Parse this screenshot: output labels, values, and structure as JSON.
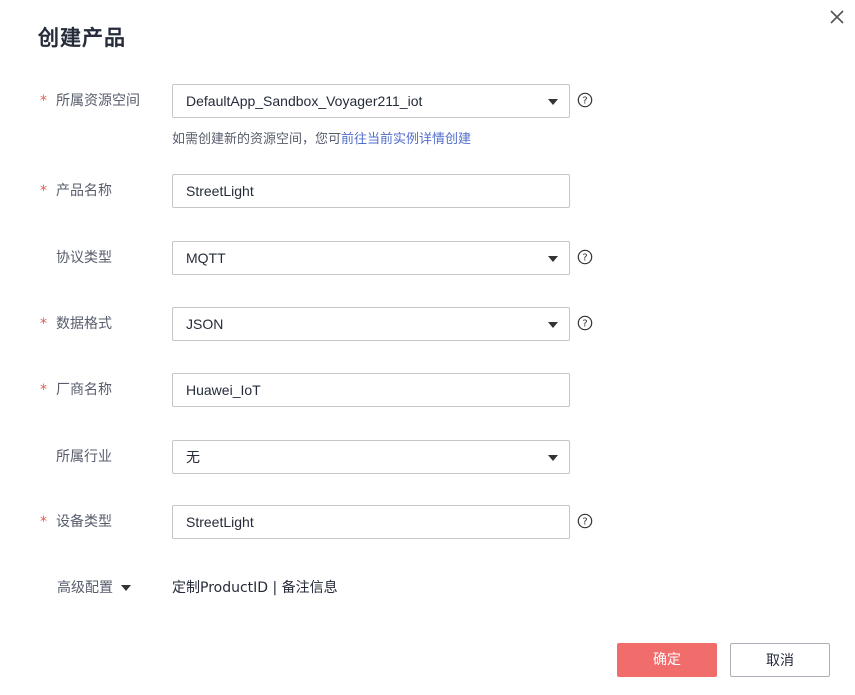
{
  "dialog": {
    "title": "创建产品",
    "close_icon": "close-icon"
  },
  "form": {
    "space": {
      "label": "所属资源空间",
      "required": true,
      "value": "DefaultApp_Sandbox_Voyager211_iot",
      "hint_text": "如需创建新的资源空间，您可",
      "hint_link": "前往当前实例详情创建"
    },
    "product_name": {
      "label": "产品名称",
      "required": true,
      "value": "StreetLight"
    },
    "protocol": {
      "label": "协议类型",
      "required": false,
      "value": "MQTT"
    },
    "data_format": {
      "label": "数据格式",
      "required": true,
      "value": "JSON"
    },
    "vendor": {
      "label": "厂商名称",
      "required": true,
      "value": "Huawei_IoT"
    },
    "industry": {
      "label": "所属行业",
      "required": false,
      "value": "无"
    },
    "device_type": {
      "label": "设备类型",
      "required": true,
      "value": "StreetLight"
    },
    "advanced": {
      "label": "高级配置",
      "text": "定制ProductID | 备注信息"
    }
  },
  "required_mark": "*",
  "buttons": {
    "confirm": "确定",
    "cancel": "取消"
  },
  "colors": {
    "required": "#e25a4f",
    "link": "#526ecc",
    "primary_button": "#f06d6c"
  }
}
